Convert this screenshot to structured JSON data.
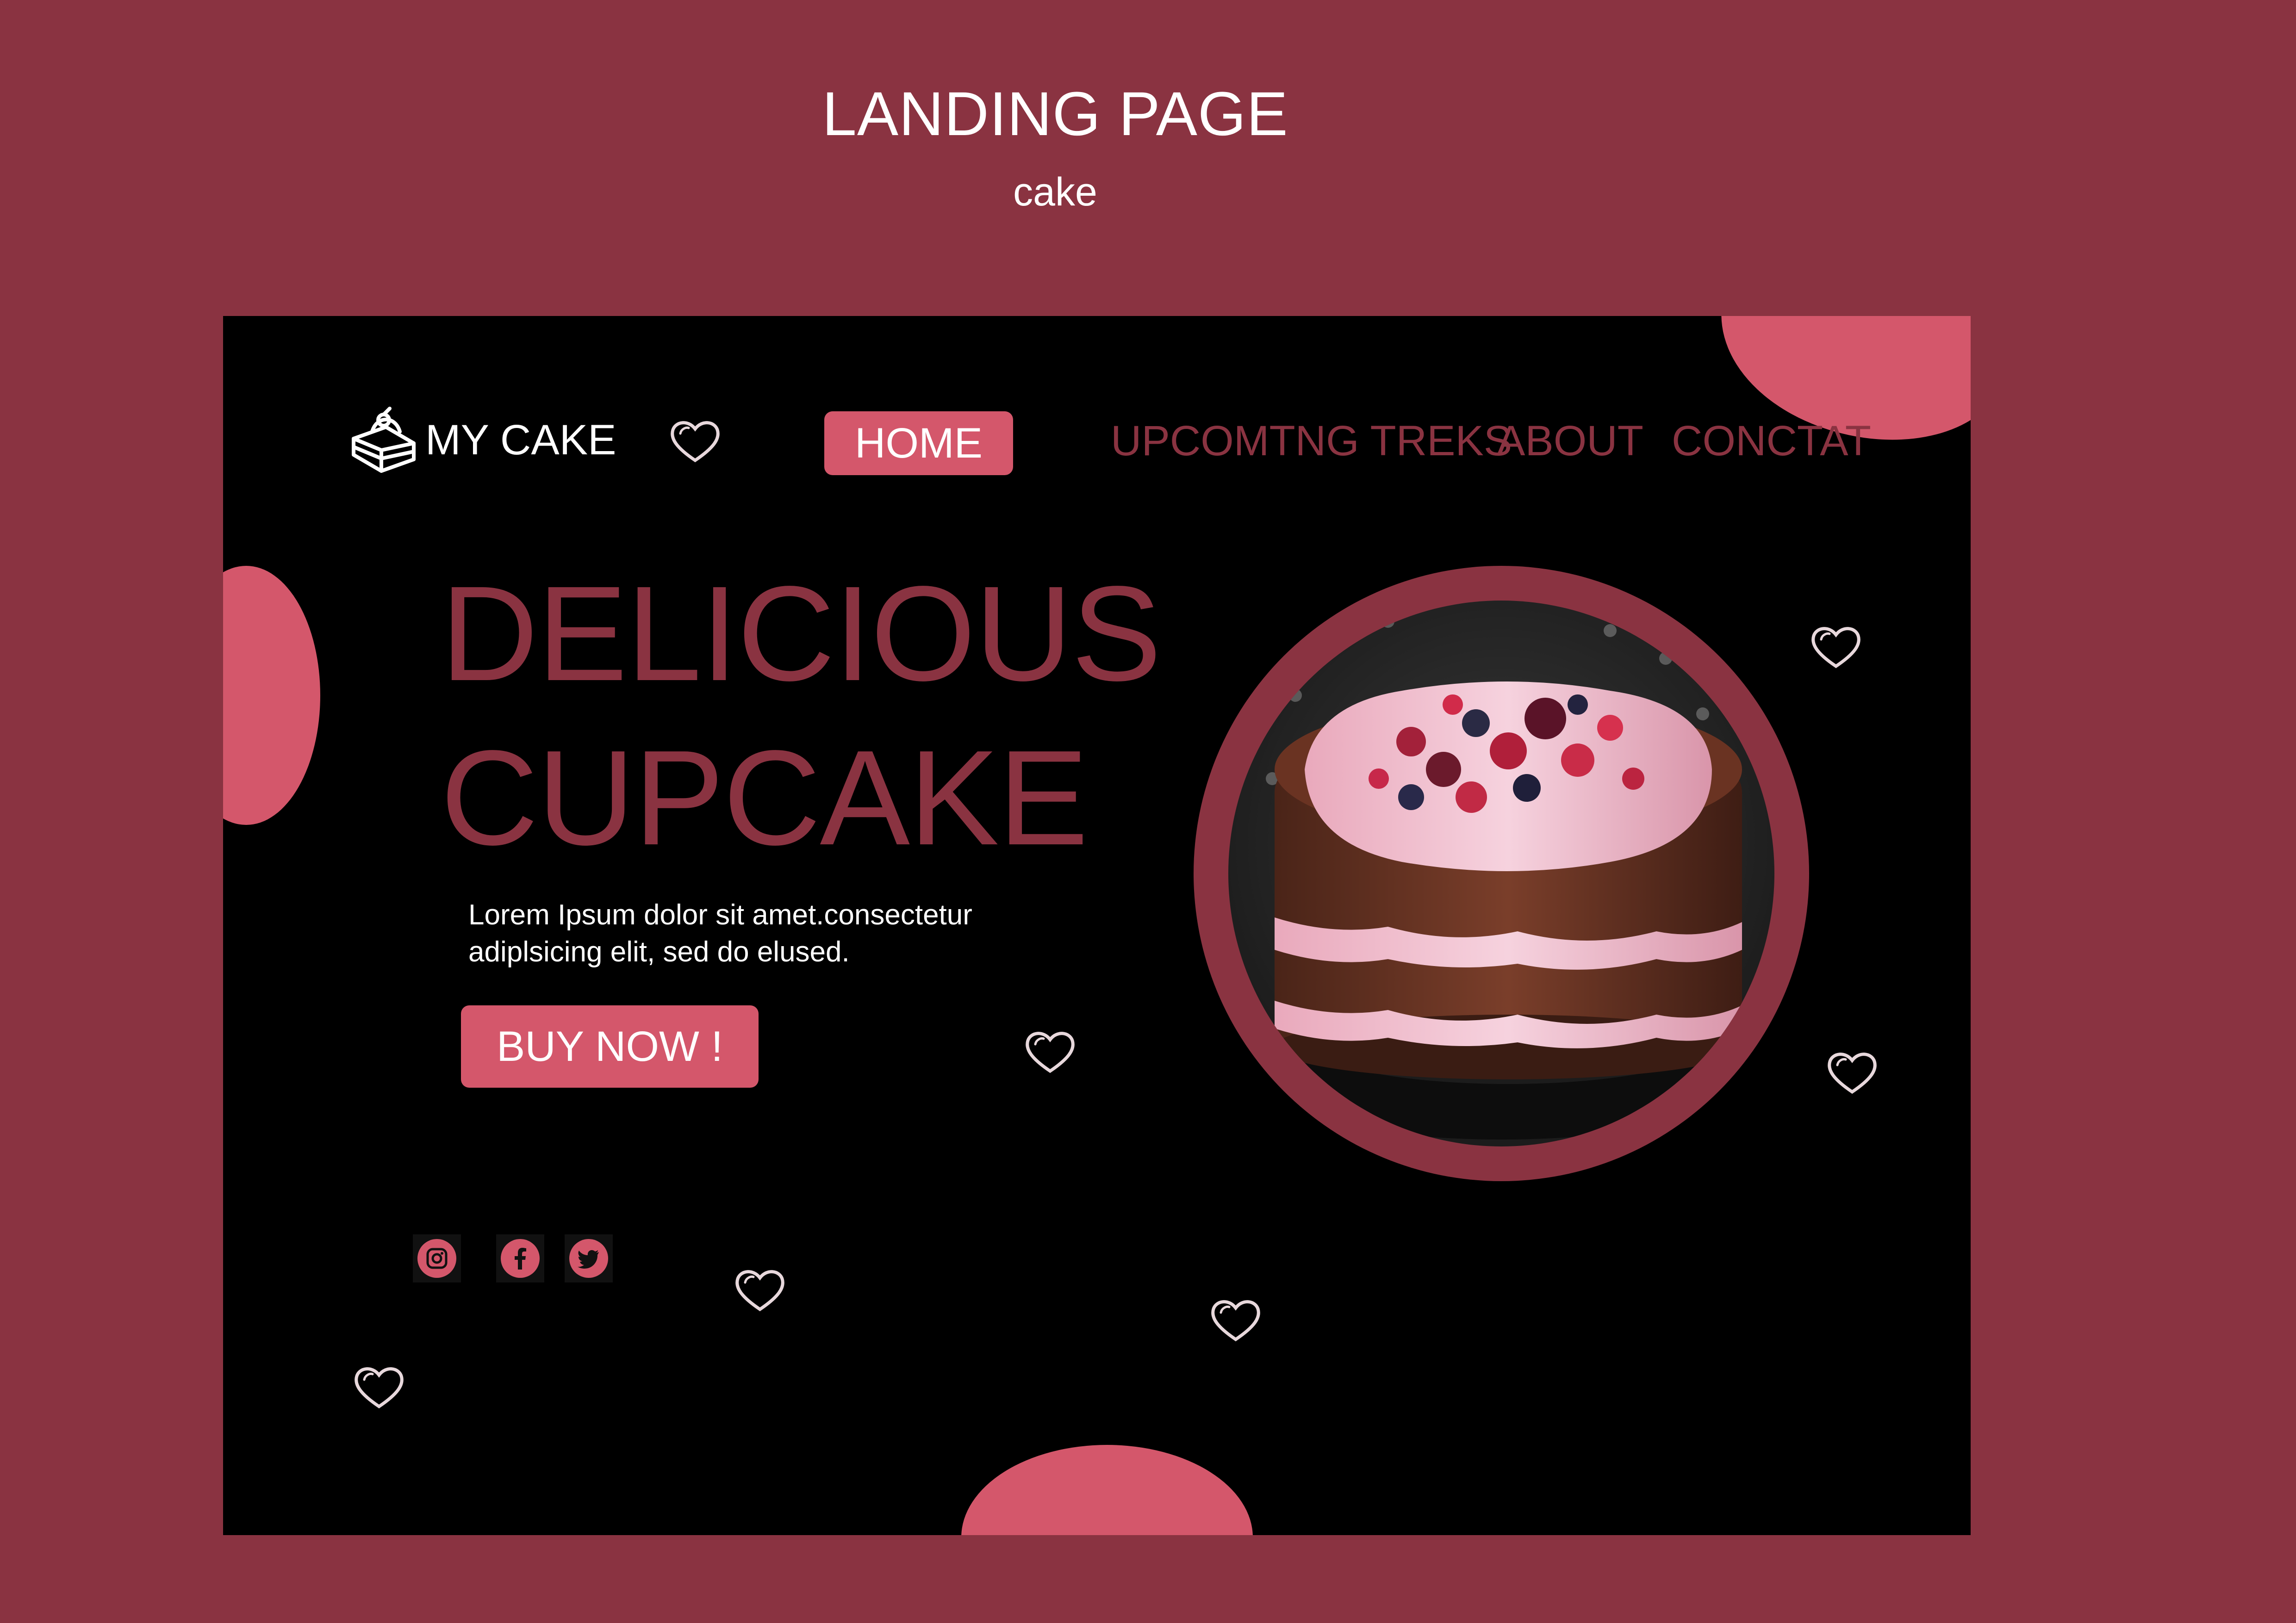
{
  "page": {
    "title": "LANDING PAGE",
    "subtitle": "cake"
  },
  "colors": {
    "background": "#8a3341",
    "panel": "#000000",
    "accent": "#d4576b",
    "heading": "#8a3341",
    "text": "#ffffff"
  },
  "nav": {
    "logo_icon": "cake-slice-icon",
    "logo_text": "MY CAKE",
    "home_label": "HOME",
    "links": [
      "UPCOMTNG TREKS",
      "ABOUT",
      "CONCTAT"
    ]
  },
  "hero": {
    "title_line1": "DELICIOUS",
    "title_line2": "CUPCAKE",
    "description_line1": "Lorem Ipsum dolor sit amet.consectetur",
    "description_line2": "adiplsicing elit, sed do elused.",
    "button_label": "BUY NOW !",
    "image_subject": "layered chocolate cake with pink cream and berries"
  },
  "social": {
    "icons": [
      "instagram-icon",
      "facebook-icon",
      "twitter-icon"
    ]
  }
}
